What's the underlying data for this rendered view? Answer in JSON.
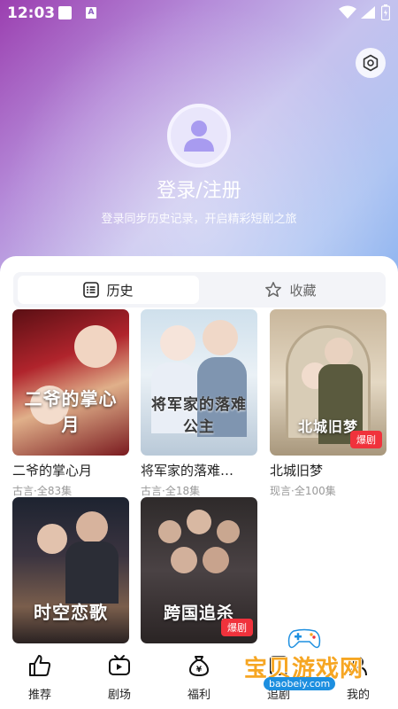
{
  "status_bar": {
    "time": "12:03"
  },
  "profile": {
    "login_title": "登录/注册",
    "login_subtitle": "登录同步历史记录，开启精彩短剧之旅"
  },
  "tabs": [
    {
      "label": "历史",
      "icon": "list-icon",
      "active": true
    },
    {
      "label": "收藏",
      "icon": "star-icon",
      "active": false
    }
  ],
  "history": [
    {
      "title": "二爷的掌心月",
      "meta": "古言·全83集",
      "poster_text": "二爷的掌心月",
      "badge": ""
    },
    {
      "title": "将军家的落难…",
      "meta": "古言·全18集",
      "poster_text": "将军家的落难公主",
      "badge": ""
    },
    {
      "title": "北城旧梦",
      "meta": "现言·全100集",
      "poster_text": "北城旧梦",
      "badge": "爆剧"
    },
    {
      "title": "",
      "meta": "",
      "poster_text": "时空恋歌",
      "badge": ""
    },
    {
      "title": "",
      "meta": "",
      "poster_text": "跨国追杀",
      "badge": "爆剧"
    }
  ],
  "bottom_nav": [
    {
      "label": "推荐",
      "icon": "thumbs-up-icon"
    },
    {
      "label": "剧场",
      "icon": "tv-icon"
    },
    {
      "label": "福利",
      "icon": "money-bag-icon"
    },
    {
      "label": "追剧",
      "icon": "bookmark-icon"
    },
    {
      "label": "我的",
      "icon": "user-icon"
    }
  ],
  "watermark": {
    "text": "宝贝游戏网",
    "url": "baobeiy.com"
  },
  "colors": {
    "accent_badge": "#f0323c",
    "header_purple": "#9b3fb0",
    "header_blue": "#8db4f0"
  }
}
